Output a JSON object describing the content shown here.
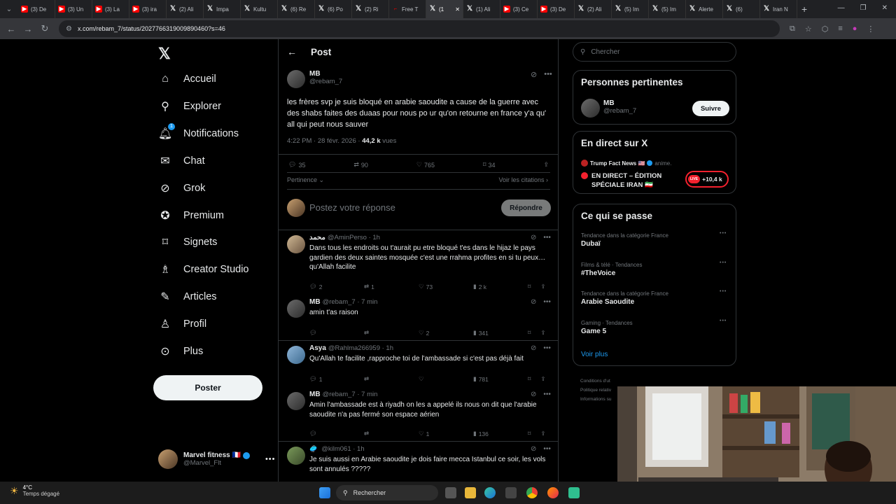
{
  "browser": {
    "tabs": [
      {
        "icon": "youtube",
        "label": "(3) De"
      },
      {
        "icon": "youtube",
        "label": "(3) Un"
      },
      {
        "icon": "youtube",
        "label": "(3) La"
      },
      {
        "icon": "youtube",
        "label": "(3) ira"
      },
      {
        "icon": "x",
        "label": "(2) Ali"
      },
      {
        "icon": "x",
        "label": "Impa"
      },
      {
        "icon": "x",
        "label": "Kultu"
      },
      {
        "icon": "x",
        "label": "(6) Re"
      },
      {
        "icon": "x",
        "label": "(6) Po"
      },
      {
        "icon": "x",
        "label": "(2) Ri"
      },
      {
        "icon": "free",
        "label": "Free T"
      },
      {
        "icon": "x",
        "label": "(1"
      },
      {
        "icon": "x",
        "label": "(1) Ali"
      },
      {
        "icon": "youtube",
        "label": "(3) Ce"
      },
      {
        "icon": "youtube",
        "label": "(3) De"
      },
      {
        "icon": "x",
        "label": "(2) Ali"
      },
      {
        "icon": "x",
        "label": "(5) Im"
      },
      {
        "icon": "x",
        "label": "(5) Im"
      },
      {
        "icon": "x",
        "label": "Alerte"
      },
      {
        "icon": "x",
        "label": "(6)"
      },
      {
        "icon": "x",
        "label": "Iran N"
      }
    ],
    "url": "x.com/rebam_7/status/2027766319009890460?s=46"
  },
  "nav": {
    "items": [
      {
        "label": "Accueil",
        "icon": "home-icon"
      },
      {
        "label": "Explorer",
        "icon": "search-icon"
      },
      {
        "label": "Notifications",
        "icon": "bell-icon",
        "badge": "1"
      },
      {
        "label": "Chat",
        "icon": "mail-icon"
      },
      {
        "label": "Grok",
        "icon": "grok-icon"
      },
      {
        "label": "Premium",
        "icon": "verified-icon"
      },
      {
        "label": "Signets",
        "icon": "bookmark-icon"
      },
      {
        "label": "Creator Studio",
        "icon": "creator-icon"
      },
      {
        "label": "Articles",
        "icon": "article-icon"
      },
      {
        "label": "Profil",
        "icon": "person-icon"
      },
      {
        "label": "Plus",
        "icon": "more-circle-icon"
      }
    ],
    "post_button": "Poster",
    "account": {
      "name": "Marvel fitness 🇫🇷",
      "handle": "@Marvel_Flt"
    }
  },
  "post": {
    "header": "Post",
    "author_name": "MB",
    "author_handle": "@rebam_7",
    "text": "les frères svp je suis bloqué en arabie saoudite a cause de la guerre avec des shabs faites des duaas pour nous po ur qu'on retourne en france y'a qu' all qui peut nous sauver",
    "time": "4:22 PM · 28 févr. 2026 · ",
    "views_count": "44,2 k",
    "views_label": " vues",
    "replies": "35",
    "retweets": "90",
    "likes": "765",
    "bookmarks": "34",
    "sort": "Pertinence",
    "quotes_link": "Voir les citations",
    "reply_placeholder": "Postez votre réponse",
    "reply_button": "Répondre"
  },
  "replies": [
    {
      "name": "محمد",
      "handle": "@AminPerso · 1h",
      "text": "Dans tous les endroits ou t'aurait pu etre bloqué t'es dans le hijaz le pays gardien des deux saintes mosquée c'est une rrahma profites en si tu peux… qu'Allah facilite",
      "replies": "2",
      "retweets": "1",
      "likes": "73",
      "views": "2 k"
    },
    {
      "name": "MB",
      "handle": "@rebam_7 · 7 min",
      "text": "amin t'as raison",
      "replies": "",
      "retweets": "",
      "likes": "2",
      "views": "341"
    },
    {
      "name": "Asya",
      "handle": "@Rahlma266959 · 1h",
      "text": "Qu'Allah te facilite ,rapproche toi de l'ambassade si c'est pas déjà fait",
      "replies": "1",
      "retweets": "",
      "likes": "",
      "views": "781"
    },
    {
      "name": "MB",
      "handle": "@rebam_7 · 7 min",
      "text": "Amin l'ambassade est à riyadh on les a appelé ils nous on dit que l'arabie saoudite n'a pas fermé son espace aérien",
      "replies": "",
      "retweets": "",
      "likes": "1",
      "views": "136"
    },
    {
      "name": "",
      "handle": "@kilm061 · 1h",
      "text": "Je suis aussi en Arabie saoudite je dois faire mecca Istanbul ce soir, les vols sont annulés ?????",
      "replies": "",
      "retweets": "",
      "likes": "",
      "views": ""
    }
  ],
  "sidebar": {
    "search_placeholder": "Chercher",
    "relevant": {
      "title": "Personnes pertinentes",
      "name": "MB",
      "handle": "@rebam_7",
      "follow": "Suivre"
    },
    "live": {
      "title": "En direct sur X",
      "host": "Trump Fact News 🇺🇸",
      "host_suffix": "anime.",
      "headline": "EN DIRECT – ÉDITION SPÉCIALE IRAN 🇮🇷",
      "live_badge": "LIVE",
      "listeners": "+10,4 k"
    },
    "trends": {
      "title": "Ce qui se passe",
      "items": [
        {
          "category": "Tendance dans la catégorie France",
          "name": "Dubaï"
        },
        {
          "category": "Films & télé · Tendances",
          "name": "#TheVoice"
        },
        {
          "category": "Tendance dans la catégorie France",
          "name": "Arabie Saoudite"
        },
        {
          "category": "Gaming · Tendances",
          "name": "Game 5"
        }
      ],
      "more": "Voir plus"
    },
    "footer": [
      "Conditions d'ut",
      "Politique relativ",
      "Informations su"
    ]
  },
  "taskbar": {
    "weather_temp": "4°C",
    "weather_desc": "Temps dégagé",
    "search": "Rechercher"
  },
  "colors": {
    "accent": "#1d9bf0",
    "live_red": "#f4212e",
    "border": "#2f3336"
  }
}
